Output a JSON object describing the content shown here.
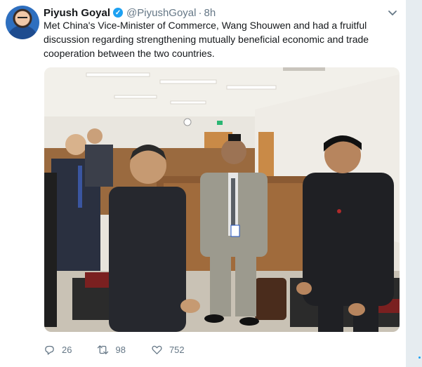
{
  "tweet": {
    "author_name": "Piyush Goyal",
    "verified_mark": "✓",
    "handle": "@PiyushGoyal",
    "separator": "·",
    "time": "8h",
    "text": "Met China's Vice-Minister of Commerce, Wang Shouwen and had a fruitful discussion regarding strengthening mutually beneficial economic and trade cooperation between the two countries.",
    "photo_icon": "photo-image",
    "actions": {
      "reply_count": "26",
      "retweet_count": "98",
      "like_count": "752"
    }
  },
  "colors": {
    "accent": "#1da1f2",
    "muted_text": "#657786",
    "rail": "#e6ecf0"
  }
}
